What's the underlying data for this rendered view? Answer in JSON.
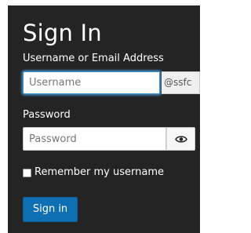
{
  "form": {
    "title": "Sign In",
    "username": {
      "label": "Username or Email Address",
      "placeholder": "Username",
      "value": "",
      "domain_suffix": "@ssfc"
    },
    "password": {
      "label": "Password",
      "placeholder": "Password",
      "value": "",
      "toggle_icon": "eye-icon"
    },
    "remember": {
      "label": "Remember my username",
      "checked": false
    },
    "submit_label": "Sign in"
  },
  "colors": {
    "panel_bg": "#242424",
    "accent": "#0e6fb2",
    "focus_ring": "#4da3e6"
  }
}
